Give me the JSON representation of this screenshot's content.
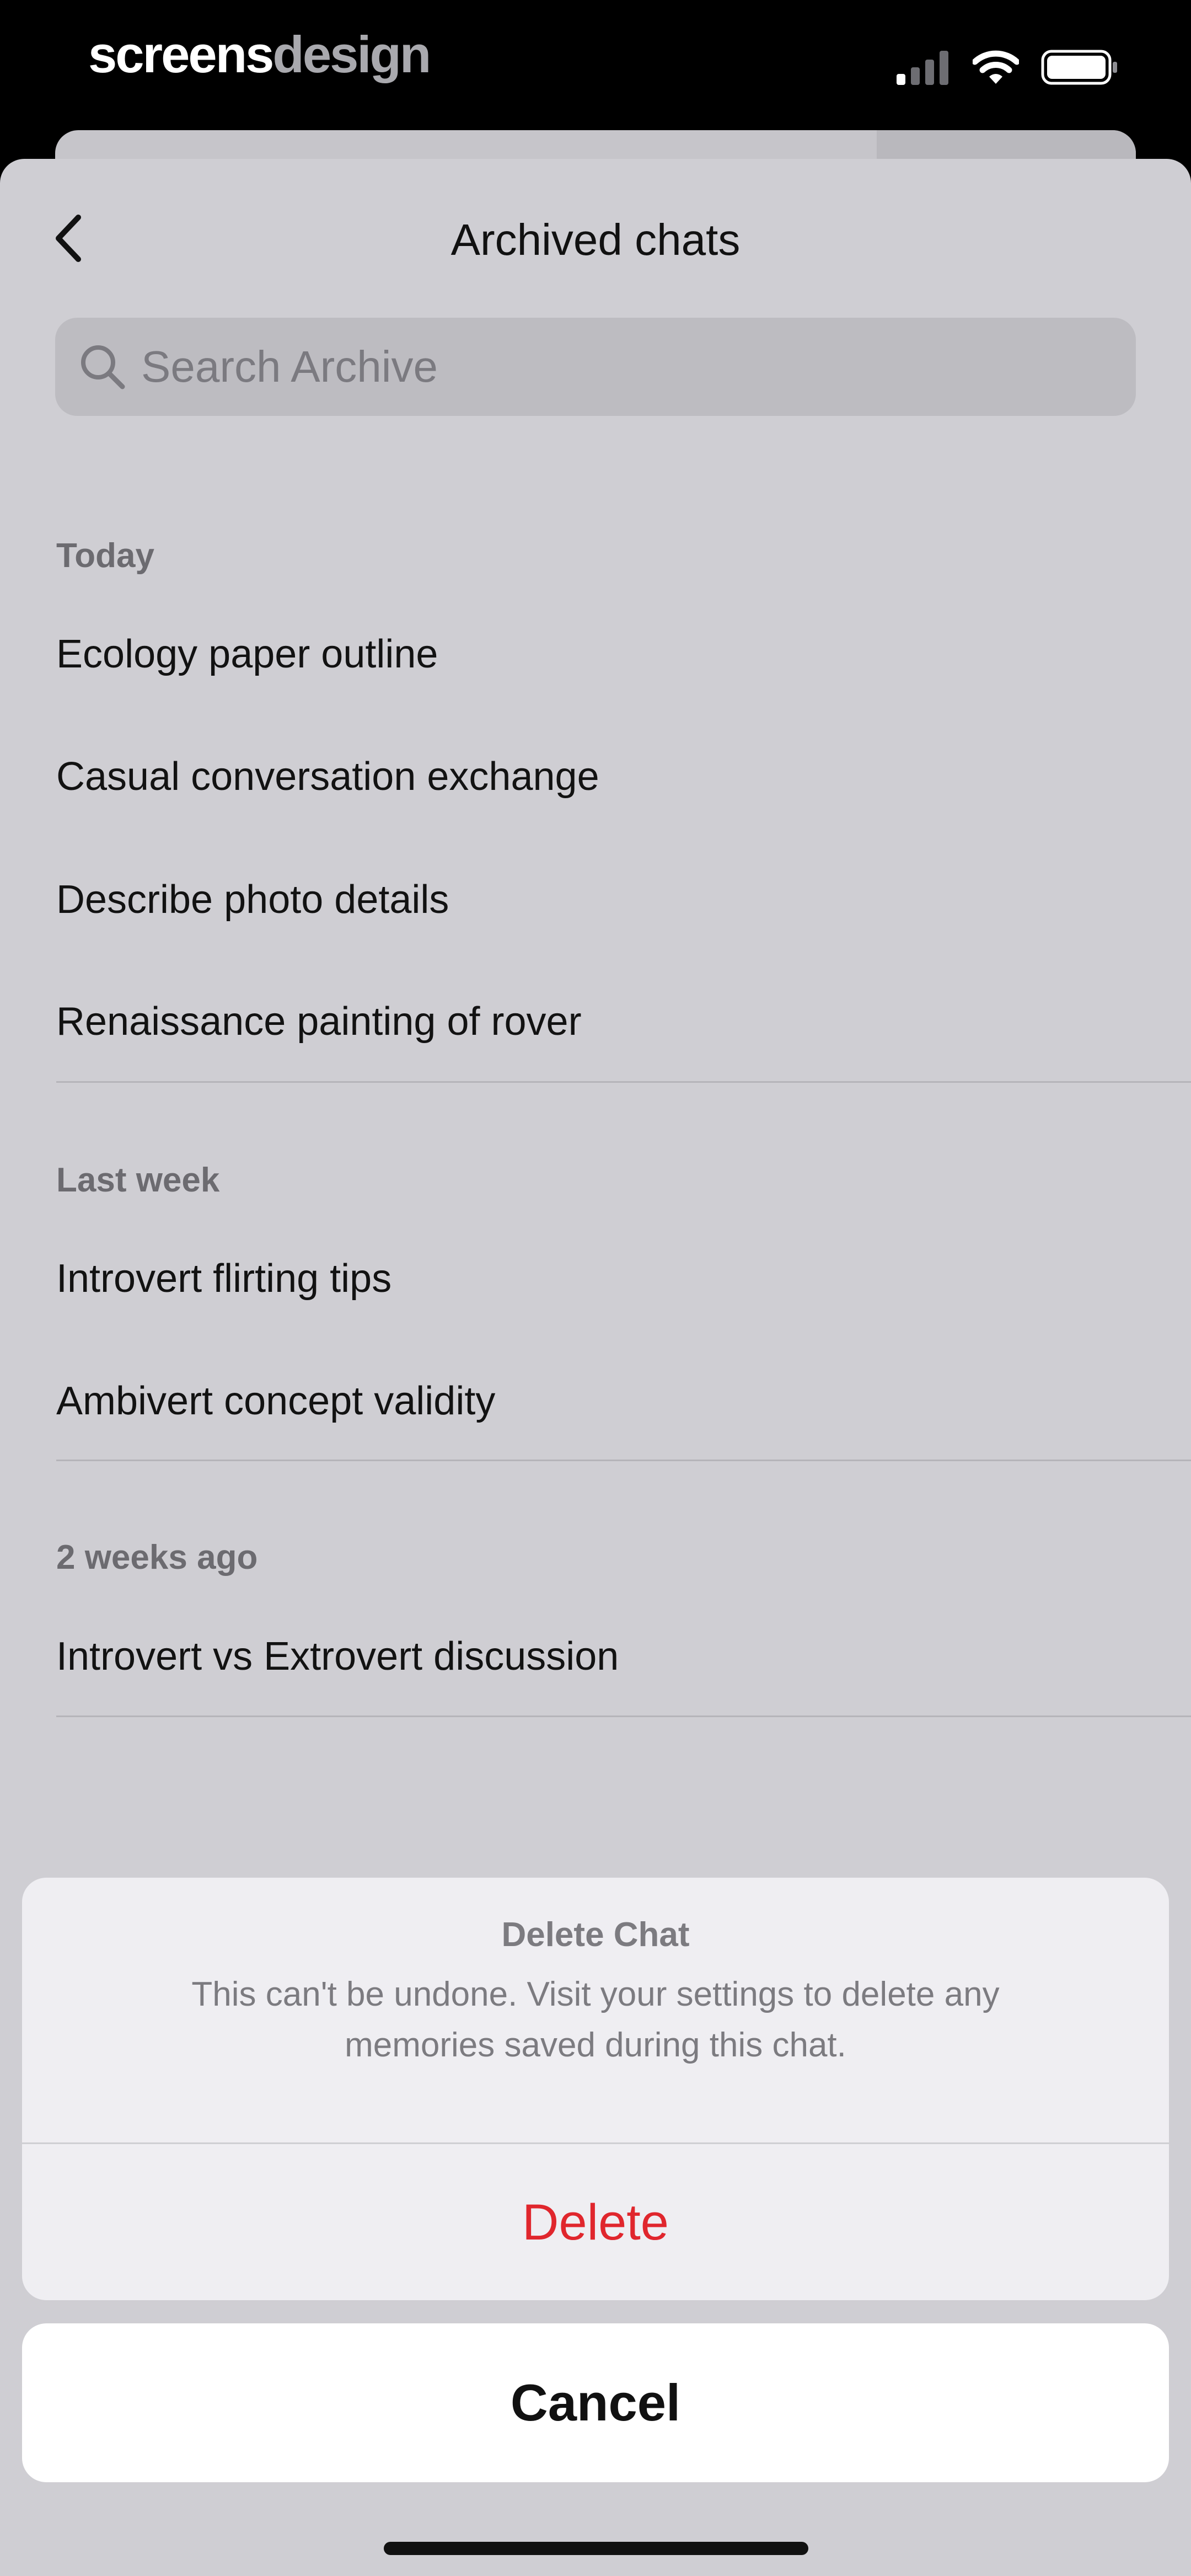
{
  "status_bar": {
    "brand_part1": "screens",
    "brand_part2": "design",
    "signal_icon": "cellular-signal-icon",
    "wifi_icon": "wifi-icon",
    "battery_icon": "battery-icon"
  },
  "header": {
    "back_icon": "chevron-left-icon",
    "title": "Archived chats"
  },
  "search": {
    "icon": "search-icon",
    "placeholder": "Search Archive",
    "value": ""
  },
  "sections": [
    {
      "label": "Today",
      "items": [
        "Ecology paper outline",
        "Casual conversation exchange",
        "Describe photo details",
        "Renaissance painting of rover"
      ]
    },
    {
      "label": "Last week",
      "items": [
        "Introvert flirting tips",
        "Ambivert concept validity"
      ]
    },
    {
      "label": "2 weeks ago",
      "items": [
        "Introvert vs Extrovert discussion"
      ]
    }
  ],
  "action_sheet": {
    "title": "Delete Chat",
    "message": "This can't be undone. Visit your settings to delete any memories saved during this chat.",
    "delete_label": "Delete",
    "cancel_label": "Cancel"
  },
  "colors": {
    "destructive": "#e0262d",
    "sheet_bg": "#cfced3",
    "action_sheet_bg": "#efeef2"
  }
}
